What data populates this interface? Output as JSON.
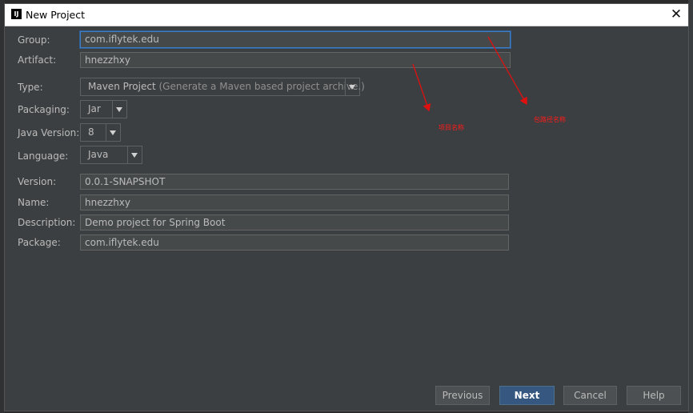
{
  "window": {
    "title": "New Project",
    "app_icon_label": "IJ",
    "close_glyph": "✕"
  },
  "form": {
    "group": {
      "label": "Group:",
      "value": "com.iflytek.edu"
    },
    "artifact": {
      "label": "Artifact:",
      "value": "hnezzhxy"
    },
    "type": {
      "label": "Type:",
      "value": "Maven Project",
      "hint": "(Generate a Maven based project archive.)"
    },
    "packaging": {
      "label": "Packaging:",
      "value": "Jar"
    },
    "java_version": {
      "label": "Java Version:",
      "value": "8"
    },
    "language": {
      "label": "Language:",
      "value": "Java"
    },
    "version": {
      "label": "Version:",
      "value": "0.0.1-SNAPSHOT"
    },
    "name": {
      "label": "Name:",
      "value": "hnezzhxy"
    },
    "description": {
      "label": "Description:",
      "value": "Demo project for Spring Boot"
    },
    "package": {
      "label": "Package:",
      "value": "com.iflytek.edu"
    }
  },
  "buttons": {
    "previous": "Previous",
    "next": "Next",
    "cancel": "Cancel",
    "help": "Help"
  },
  "annotations": {
    "arrow_color": "#e01010",
    "left_note": "项目名称",
    "right_note": "包路径名称"
  },
  "colors": {
    "dialog_bg": "#3c3f41",
    "field_bg": "#45494a",
    "text": "#bbbbbb",
    "focus_border": "#3d7ec6",
    "default_button": "#365880"
  }
}
